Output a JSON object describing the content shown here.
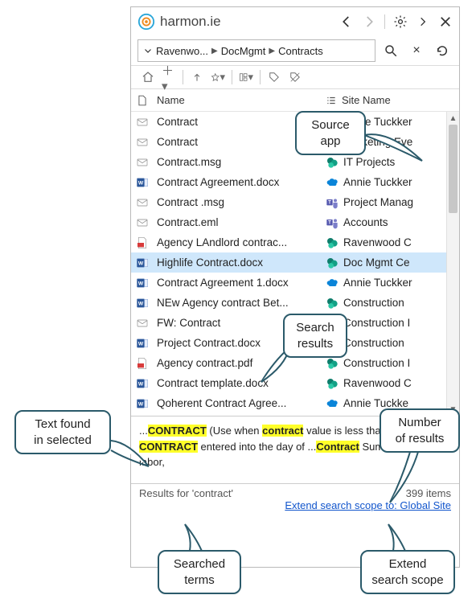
{
  "brand": {
    "name": "harmon.ie"
  },
  "breadcrumb": {
    "parts": [
      "Ravenwo...",
      "DocMgmt",
      "Contracts"
    ]
  },
  "columns": {
    "name": "Name",
    "site": "Site Name"
  },
  "rows": [
    {
      "icon": "mail",
      "name": "Contract",
      "siteicon": "onedrive",
      "site": "Annie Tuckker"
    },
    {
      "icon": "mail",
      "name": "Contract",
      "siteicon": "sharepoint",
      "site": "Marketing Eve"
    },
    {
      "icon": "mail",
      "name": "Contract.msg",
      "siteicon": "sharepoint",
      "site": "IT Projects"
    },
    {
      "icon": "word",
      "name": "Contract Agreement.docx",
      "siteicon": "onedrive",
      "site": "Annie Tuckker"
    },
    {
      "icon": "mail",
      "name": "Contract .msg",
      "siteicon": "teams",
      "site": "Project Manag"
    },
    {
      "icon": "mail",
      "name": "Contract.eml",
      "siteicon": "teams",
      "site": "Accounts"
    },
    {
      "icon": "pdf",
      "name": "Agency LAndlord contrac...",
      "siteicon": "sharepoint",
      "site": "Ravenwood C"
    },
    {
      "icon": "word",
      "name": "Highlife Contract.docx",
      "siteicon": "sharepoint",
      "site": "Doc Mgmt Ce",
      "selected": true
    },
    {
      "icon": "word",
      "name": "Contract Agreement 1.docx",
      "siteicon": "onedrive",
      "site": "Annie Tuckker"
    },
    {
      "icon": "word",
      "name": "NEw Agency contract Bet...",
      "siteicon": "sharepoint",
      "site": "Construction"
    },
    {
      "icon": "mail",
      "name": "FW: Contract",
      "siteicon": "sharepoint",
      "site": "Construction I"
    },
    {
      "icon": "word",
      "name": "Project Contract.docx",
      "siteicon": "sharepoint",
      "site": "Construction"
    },
    {
      "icon": "pdf",
      "name": "Agency contract.pdf",
      "siteicon": "sharepoint",
      "site": "Construction I"
    },
    {
      "icon": "word",
      "name": "Contract template.docx",
      "siteicon": "sharepoint",
      "site": "Ravenwood C"
    },
    {
      "icon": "word",
      "name": "Qoherent Contract Agree...",
      "siteicon": "onedrive",
      "site": "Annie Tuckke"
    }
  ],
  "preview": {
    "pre1": "...",
    "h1": "CONTRACT",
    "t1": " (Use when ",
    "h2": "contract",
    "t2": " value is less than $50,000) ",
    "h3": "CONTRACT",
    "t3": " entered into the day of ...",
    "h4": "Contract",
    "t4": " Sum to furnish all labor,"
  },
  "results": {
    "label": "Results for 'contract'",
    "count": "399 items",
    "extend": "Extend search scope to: Global Site"
  },
  "callouts": {
    "source": "Source\napp",
    "results": "Search\nresults",
    "textfound": "Text found\nin selected",
    "numres": "Number\nof results",
    "terms": "Searched\nterms",
    "extend": "Extend\nsearch scope"
  }
}
